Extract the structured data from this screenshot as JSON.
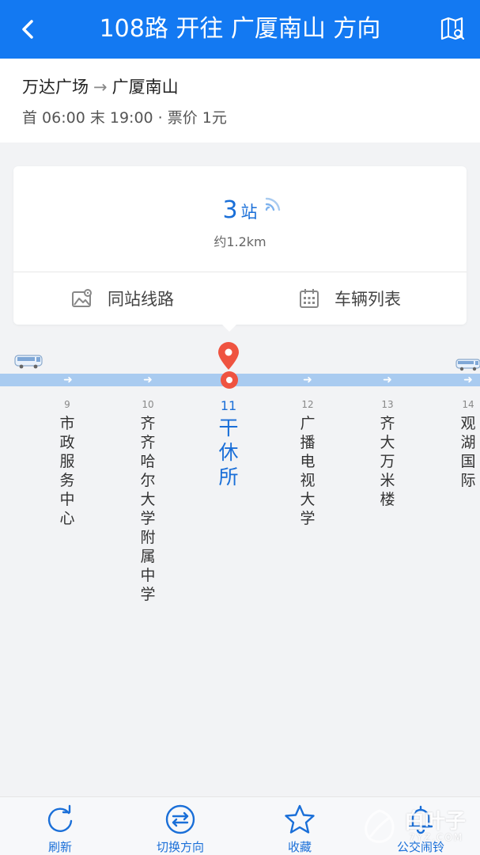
{
  "header": {
    "title": "108路 开往 广厦南山 方向",
    "back_icon": "chevron-left-icon",
    "map_icon": "map-icon"
  },
  "route": {
    "from": "万达广场",
    "arrow": "→",
    "to": "广厦南山",
    "schedule": "首 06:00 末 19:00 · 票价 1元"
  },
  "card": {
    "stops_count": "3",
    "stops_unit": "站",
    "distance": "约1.2km",
    "actions": [
      {
        "label": "同站线路",
        "icon": "map-photo-icon"
      },
      {
        "label": "车辆列表",
        "icon": "calendar-icon"
      }
    ]
  },
  "stops": [
    {
      "index": "9",
      "name": "市政服务中心"
    },
    {
      "index": "10",
      "name": "齐齐哈尔大学附属中学"
    },
    {
      "index": "11",
      "name": "干休所",
      "current": true
    },
    {
      "index": "12",
      "name": "广播电视大学"
    },
    {
      "index": "13",
      "name": "齐大万米楼"
    },
    {
      "index": "14",
      "name": "观湖国际"
    }
  ],
  "bottom_tabs": [
    {
      "label": "刷新",
      "icon": "refresh-icon"
    },
    {
      "label": "切换方向",
      "icon": "switch-direction-icon"
    },
    {
      "label": "收藏",
      "icon": "star-icon"
    },
    {
      "label": "公交闹铃",
      "icon": "bell-icon"
    }
  ],
  "watermark": {
    "text": "白叶子",
    "sub": "7YZ.COM"
  },
  "colors": {
    "primary": "#1379f2",
    "accent_text": "#1a6fd8",
    "current_stop": "#ef5340",
    "track": "#a9cbf0"
  }
}
